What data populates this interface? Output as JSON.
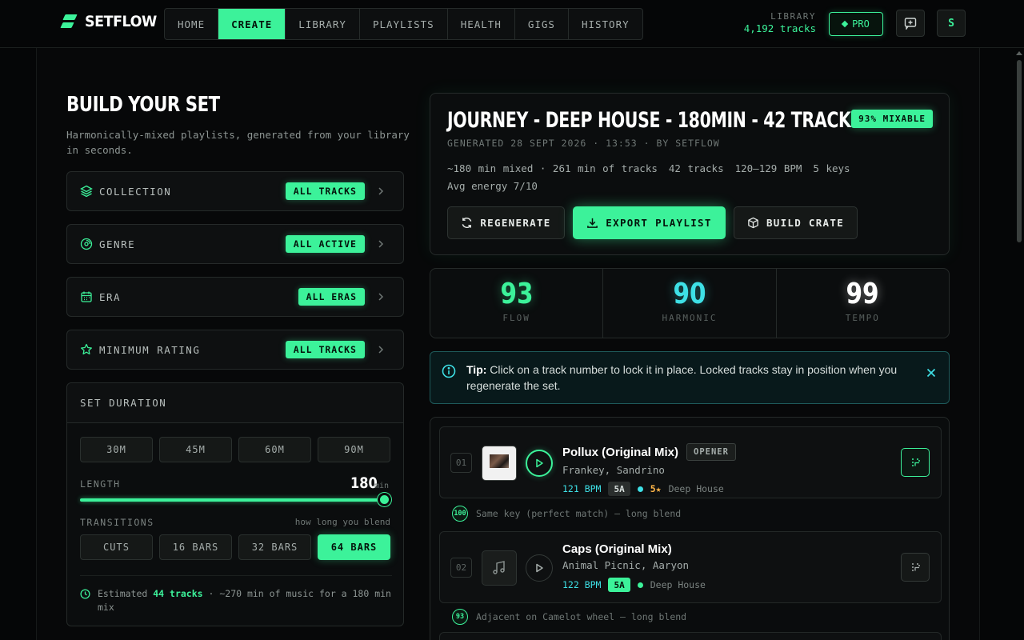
{
  "header": {
    "brand": "SETFLOW",
    "nav": [
      "HOME",
      "CREATE",
      "LIBRARY",
      "PLAYLISTS",
      "HEALTH",
      "GIGS",
      "HISTORY"
    ],
    "active_tab": "CREATE",
    "library_label": "LIBRARY",
    "library_count": "4,192 tracks",
    "pro_label": "PRO",
    "avatar_initial": "S"
  },
  "builder": {
    "title": "BUILD YOUR SET",
    "subtitle": "Harmonically-mixed playlists, generated from your library in seconds.",
    "filters": [
      {
        "label": "COLLECTION",
        "value": "ALL TRACKS",
        "icon": "layers-icon"
      },
      {
        "label": "GENRE",
        "value": "ALL ACTIVE",
        "icon": "vinyl-icon"
      },
      {
        "label": "ERA",
        "value": "ALL ERAS",
        "icon": "calendar-icon"
      },
      {
        "label": "MINIMUM RATING",
        "value": "ALL TRACKS",
        "icon": "star-icon"
      }
    ],
    "duration": {
      "heading": "SET DURATION",
      "presets": [
        "30M",
        "45M",
        "60M",
        "90M"
      ],
      "length_label": "LENGTH",
      "length_value": "180",
      "length_unit": "min",
      "slider_fraction": 1.0,
      "transitions_label": "TRANSITIONS",
      "transitions_hint": "how long you blend",
      "transition_options": [
        "CUTS",
        "16 BARS",
        "32 BARS",
        "64 BARS"
      ],
      "selected_transition": "64 BARS",
      "estimate_prefix": "Estimated",
      "estimate_tracks": "44 tracks",
      "estimate_suffix": "· ~270 min of music for a 180 min mix"
    }
  },
  "summary": {
    "title": "JOURNEY - DEEP HOUSE - 180MIN - 42 TRACKS",
    "mixable_badge": "93% MIXABLE",
    "generated": "GENERATED 28 SEPT 2026 · 13:53 · BY SETFLOW",
    "stats": [
      "~180 min mixed · 261 min of tracks",
      "42 tracks",
      "120–129 BPM",
      "5 keys"
    ],
    "avg_energy": "Avg energy 7/10",
    "buttons": {
      "regenerate": "REGENERATE",
      "export": "EXPORT PLAYLIST",
      "crate": "BUILD CRATE"
    }
  },
  "scores": [
    {
      "value": "93",
      "label": "FLOW",
      "color": "#3cf29a"
    },
    {
      "value": "90",
      "label": "HARMONIC",
      "color": "#3ee0e6"
    },
    {
      "value": "99",
      "label": "TEMPO",
      "color": "#ffffff"
    }
  ],
  "tip": {
    "label": "Tip:",
    "text": "Click on a track number to lock it in place. Locked tracks stay in position when you regenerate the set."
  },
  "tracks": [
    {
      "num": "01",
      "title": "Pollux (Original Mix)",
      "role": "OPENER",
      "artist": "Frankey, Sandrino",
      "bpm": "121 BPM",
      "key": "5A",
      "rating": "5★",
      "genre": "Deep House"
    },
    {
      "num": "02",
      "title": "Caps (Original Mix)",
      "role": "",
      "artist": "Animal Picnic, Aaryon",
      "bpm": "122 BPM",
      "key": "5A",
      "rating": "",
      "genre": "Deep House"
    }
  ],
  "transitions": [
    {
      "score": "100",
      "text": "Same key (perfect match) — long blend"
    },
    {
      "score": "93",
      "text": "Adjacent on Camelot wheel — long blend"
    }
  ]
}
